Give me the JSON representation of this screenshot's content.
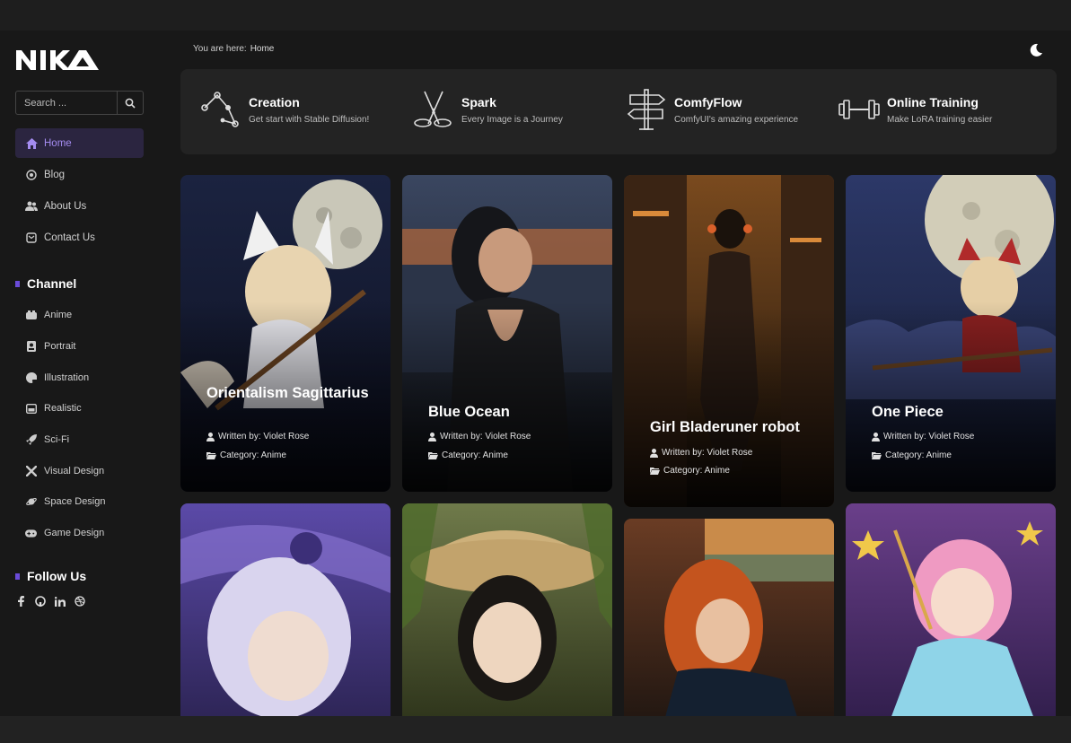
{
  "brand": {
    "logo_text": "NIKA"
  },
  "search": {
    "placeholder": "Search ...",
    "icon": "search-icon"
  },
  "nav": {
    "items": [
      {
        "label": "Home",
        "icon": "home-icon",
        "active": true
      },
      {
        "label": "Blog",
        "icon": "blog-icon",
        "active": false
      },
      {
        "label": "About Us",
        "icon": "users-icon",
        "active": false
      },
      {
        "label": "Contact Us",
        "icon": "contact-icon",
        "active": false
      }
    ]
  },
  "channel": {
    "title": "Channel",
    "items": [
      {
        "label": "Anime",
        "icon": "anime-icon"
      },
      {
        "label": "Portrait",
        "icon": "portrait-icon"
      },
      {
        "label": "Illustration",
        "icon": "palette-icon"
      },
      {
        "label": "Realistic",
        "icon": "image-icon"
      },
      {
        "label": "Sci-Fi",
        "icon": "rocket-icon"
      },
      {
        "label": "Visual Design",
        "icon": "tools-icon"
      },
      {
        "label": "Space Design",
        "icon": "planet-icon"
      },
      {
        "label": "Game Design",
        "icon": "gamepad-icon"
      }
    ]
  },
  "follow": {
    "title": "Follow Us",
    "links": [
      "facebook-icon",
      "github-icon",
      "linkedin-icon",
      "dribbble-icon"
    ]
  },
  "breadcrumb": {
    "prefix": "You are here:",
    "current": "Home"
  },
  "theme_toggle": {
    "icon": "moon-icon"
  },
  "features": [
    {
      "title": "Creation",
      "subtitle": "Get start with Stable Diffusion!",
      "icon": "nodes-icon"
    },
    {
      "title": "Spark",
      "subtitle": "Every Image is a Journey",
      "icon": "spark-icon"
    },
    {
      "title": "ComfyFlow",
      "subtitle": "ComfyUI's amazing experience",
      "icon": "signpost-icon"
    },
    {
      "title": "Online Training",
      "subtitle": "Make LoRA training easier",
      "icon": "dumbbell-icon"
    }
  ],
  "cards": [
    {
      "title": "Orientalism Sagittarius",
      "author": "Written by: Violet Rose",
      "category": "Category: Anime",
      "colors": [
        "#1b2340",
        "#0d1020"
      ]
    },
    {
      "title": "Blue Ocean",
      "author": "Written by: Violet Rose",
      "category": "Category: Anime",
      "colors": [
        "#3a4660",
        "#121418"
      ]
    },
    {
      "title": "Girl Bladeruner robot",
      "author": "Written by: Violet Rose",
      "category": "Category: Anime",
      "colors": [
        "#7a4a1e",
        "#1e140c"
      ]
    },
    {
      "title": "One Piece",
      "author": "Written by: Violet Rose",
      "category": "Category: Anime",
      "colors": [
        "#2c3868",
        "#141a30"
      ]
    }
  ],
  "cards_row2": [
    {
      "colors": [
        "#5b4aa8",
        "#2a2250"
      ]
    },
    {
      "colors": [
        "#6f7a4a",
        "#2a3018"
      ]
    },
    {
      "colors": [
        "#6a3c24",
        "#1c1410"
      ]
    },
    {
      "colors": [
        "#6a3f8a",
        "#2d1c48"
      ]
    }
  ],
  "accent": "#6a4bd8"
}
